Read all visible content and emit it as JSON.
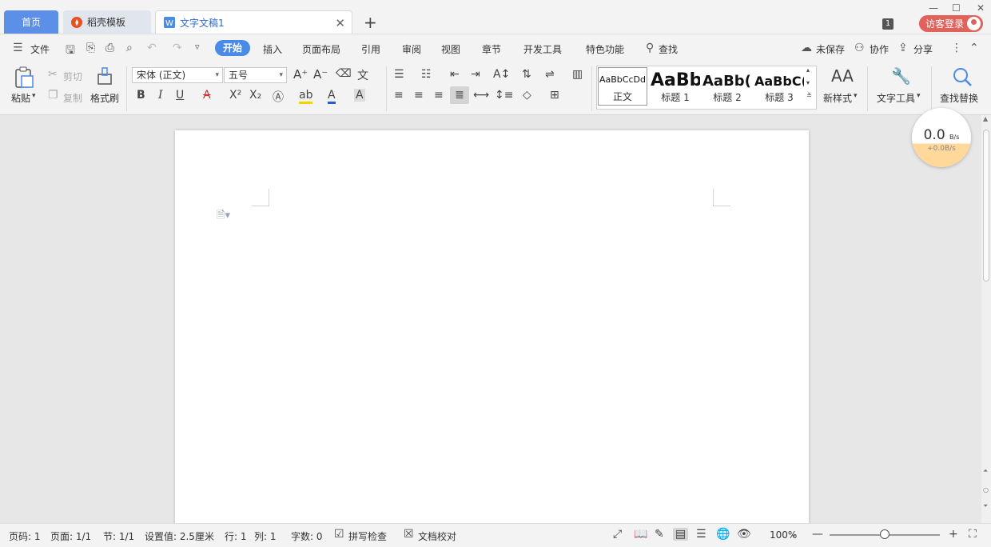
{
  "tabs": {
    "home": "首页",
    "template": "稻壳模板",
    "doc": "文字文稿1"
  },
  "window": {
    "minimize": "—",
    "restore": "☐",
    "close": "✕",
    "count_badge": "1",
    "login": "访客登录"
  },
  "menu": {
    "file": "文件",
    "items": [
      "开始",
      "插入",
      "页面布局",
      "引用",
      "审阅",
      "视图",
      "章节",
      "开发工具",
      "特色功能"
    ],
    "search": "查找",
    "unsaved": "未保存",
    "collab": "协作",
    "share": "分享"
  },
  "ribbon": {
    "paste": "粘贴",
    "cut": "剪切",
    "copy": "复制",
    "format_painter": "格式刷",
    "font_name": "宋体 (正文)",
    "font_size": "五号",
    "styles": [
      {
        "preview": "AaBbCcDd",
        "name": "正文"
      },
      {
        "preview": "AaBb",
        "name": "标题 1"
      },
      {
        "preview": "AaBb(",
        "name": "标题 2"
      },
      {
        "preview": "AaBbC(",
        "name": "标题 3"
      }
    ],
    "new_style": "新样式",
    "text_tools": "文字工具",
    "find_replace": "查找替换"
  },
  "speed": {
    "value": "0.0",
    "unit": "B/s",
    "sub": "+0.0B/s"
  },
  "status": {
    "page_num": "页码: 1",
    "pages": "页面: 1/1",
    "section": "节: 1/1",
    "setting": "设置值: 2.5厘米",
    "row": "行: 1",
    "col": "列: 1",
    "words": "字数: 0",
    "spell": "拼写检查",
    "proof": "文档校对",
    "zoom": "100%"
  },
  "colors": {
    "accent": "#4a8be8",
    "home_tab": "#5b8fe8",
    "login": "#e0625b"
  }
}
